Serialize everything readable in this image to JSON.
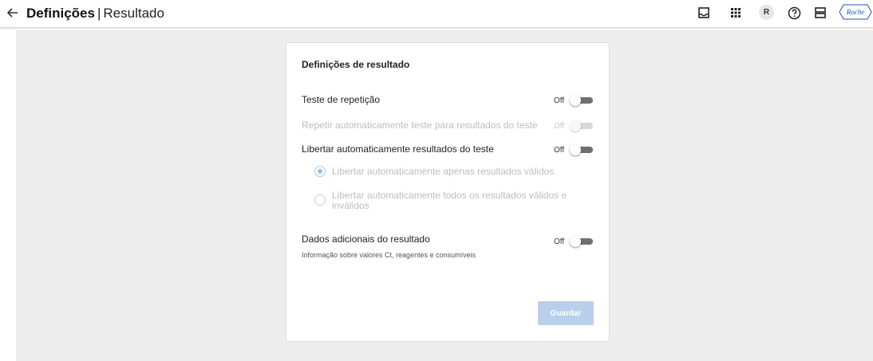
{
  "header": {
    "title": "Definições",
    "separator": "|",
    "subtitle": "Resultado",
    "avatar_initial": "R",
    "logo_text": "Roche",
    "icons": [
      "arrow-back-icon",
      "inbox-icon",
      "apps-grid-icon",
      "avatar",
      "help-icon",
      "storage-icon",
      "roche-logo"
    ]
  },
  "card": {
    "title": "Definições de resultado",
    "settings": [
      {
        "label": "Teste de repetição",
        "state": "Off",
        "enabled": true
      },
      {
        "label": "Repetir automaticamente teste para resultados do teste",
        "state": "Off",
        "enabled": false
      },
      {
        "label": "Libertar automaticamente resultados do teste",
        "state": "Off",
        "enabled": true
      },
      {
        "label": "Dados adicionais do resultado",
        "description": "Informação sobre valores Ct, reagentes e consumíveis",
        "state": "Off",
        "enabled": true
      }
    ],
    "radio_options": [
      {
        "label": "Libertar automaticamente apenas resultados válidos",
        "checked": true
      },
      {
        "label": "Libertar automaticamente todos os resultados válidos e inválidos",
        "checked": false
      }
    ],
    "save_label": "Guardar"
  },
  "colors": {
    "background": "#ededed",
    "card": "#ffffff",
    "toggle_track": "#6f6f6f",
    "save_button_disabled": "#b9cfec",
    "logo_blue": "#1e56a8"
  }
}
